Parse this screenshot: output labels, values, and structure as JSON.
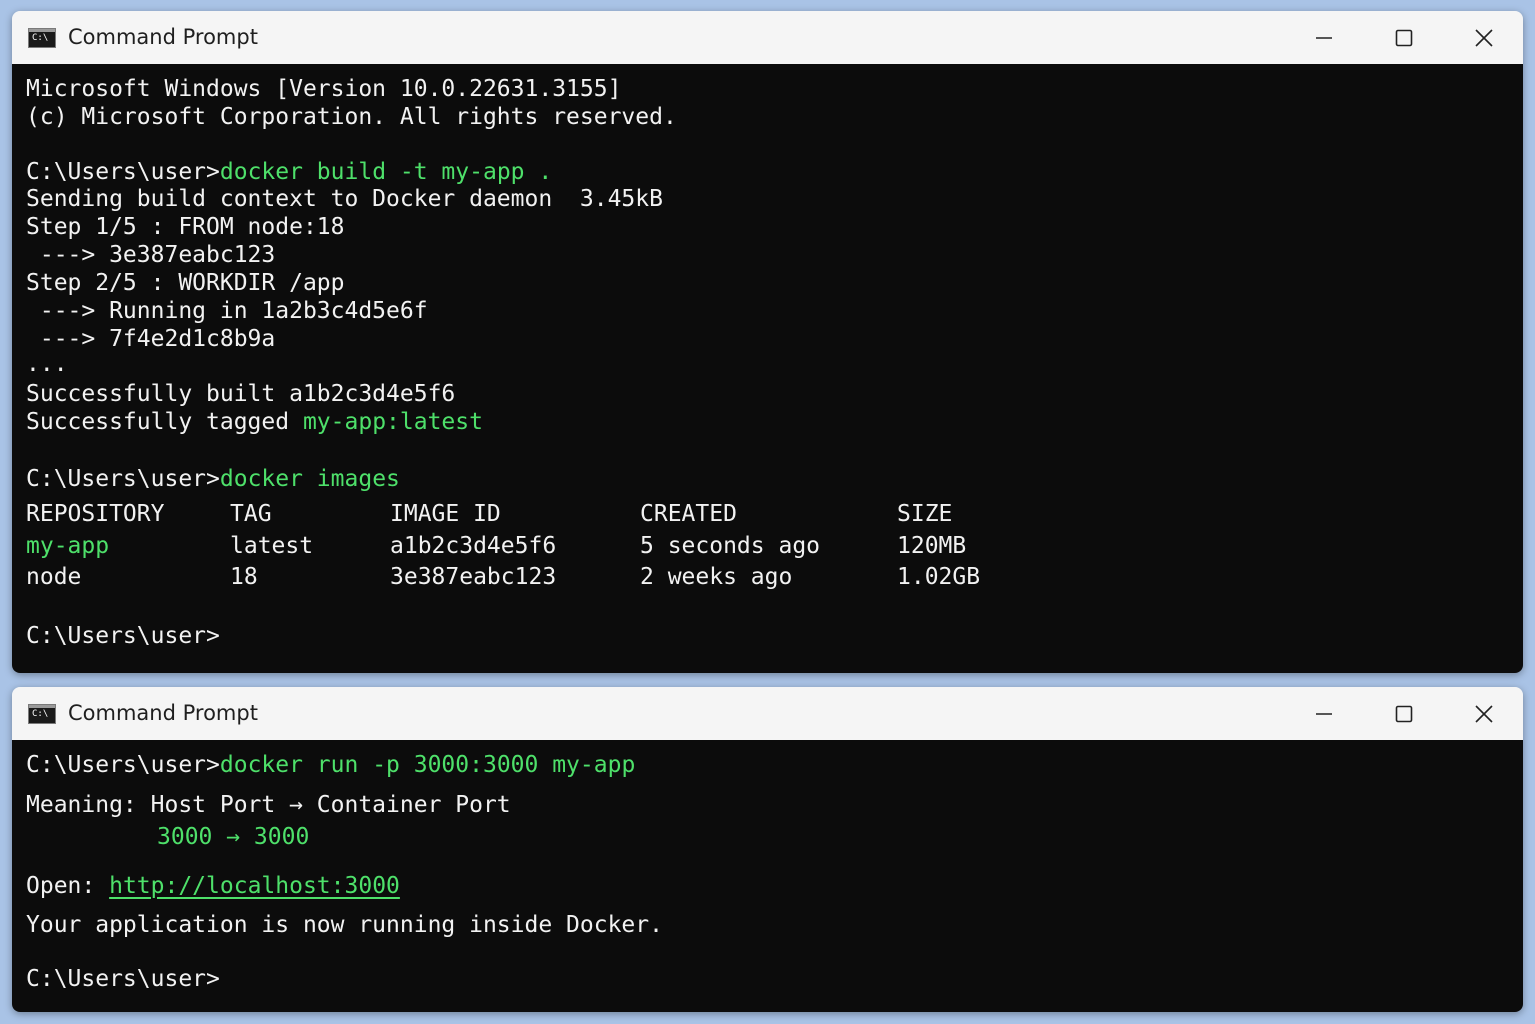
{
  "window1": {
    "title": "Command Prompt",
    "icon": "cmd-icon",
    "banner1": "Microsoft Windows [Version 10.0.22631.3155]",
    "banner2": "(c) Microsoft Corporation. All rights reserved.",
    "prompt": "C:\\Users\\user>",
    "cmd_build": "docker build -t my-app .",
    "build_lines": [
      "Sending build context to Docker daemon  3.45kB",
      "Step 1/5 : FROM node:18",
      " ---> 3e387eabc123",
      "Step 2/5 : WORKDIR /app",
      " ---> Running in 1a2b3c4d5e6f",
      " ---> 7f4e2d1c8b9a",
      "...",
      "Successfully built a1b2c3d4e5f6"
    ],
    "tagged_prefix": "Successfully tagged ",
    "tagged_name": "my-app:latest",
    "cmd_images": "docker images",
    "table": {
      "headers": [
        "REPOSITORY",
        "TAG",
        "IMAGE ID",
        "CREATED",
        "SIZE"
      ],
      "rows": [
        [
          "my-app",
          "latest",
          "a1b2c3d4e5f6",
          "5 seconds ago",
          "120MB"
        ],
        [
          "node",
          "18",
          "3e387eabc123",
          "2 weeks ago",
          "1.02GB"
        ]
      ]
    }
  },
  "window2": {
    "title": "Command Prompt",
    "prompt": "C:\\Users\\user>",
    "cmd_run": "docker run -p 3000:3000 my-app",
    "meaning_label": "Meaning: ",
    "meaning_text": "Host Port → Container Port",
    "port_line": "3000 → 3000",
    "open_label": "Open: ",
    "open_url": "http://localhost:3000",
    "running_text": "Your application is now running inside Docker."
  },
  "colors": {
    "terminal_bg": "#0c0c0c",
    "terminal_fg": "#f2f2f2",
    "accent_green": "#4ee06a",
    "titlebar_bg": "#f5f5f5",
    "desktop_bg": "#a9c3e6"
  }
}
